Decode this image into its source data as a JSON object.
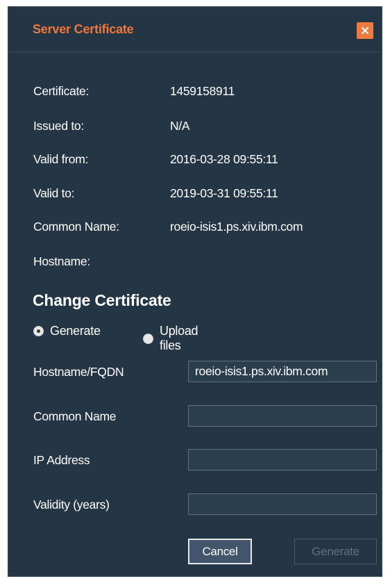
{
  "dialog": {
    "title": "Server Certificate",
    "close_icon": "close-icon",
    "accent_color": "#f0763a",
    "background_color": "#243646"
  },
  "info": [
    {
      "label": "Certificate:",
      "value": "1459158911"
    },
    {
      "label": "Issued to:",
      "value": "N/A"
    },
    {
      "label": "Valid from:",
      "value": "2016-03-28 09:55:11"
    },
    {
      "label": "Valid to:",
      "value": "2019-03-31 09:55:11"
    },
    {
      "label": "Common Name:",
      "value": "roeio-isis1.ps.xiv.ibm.com"
    },
    {
      "label": "Hostname:",
      "value": ""
    }
  ],
  "change": {
    "title": "Change Certificate",
    "radios": [
      {
        "label": "Generate",
        "checked": true
      },
      {
        "label": "Upload files",
        "checked": false
      }
    ]
  },
  "form": {
    "fields": [
      {
        "label": "Hostname/FQDN",
        "value": "roeio-isis1.ps.xiv.ibm.com"
      },
      {
        "label": "Common Name",
        "value": ""
      },
      {
        "label": "IP Address",
        "value": ""
      },
      {
        "label": "Validity (years)",
        "value": ""
      }
    ]
  },
  "buttons": {
    "cancel": "Cancel",
    "generate": "Generate"
  }
}
